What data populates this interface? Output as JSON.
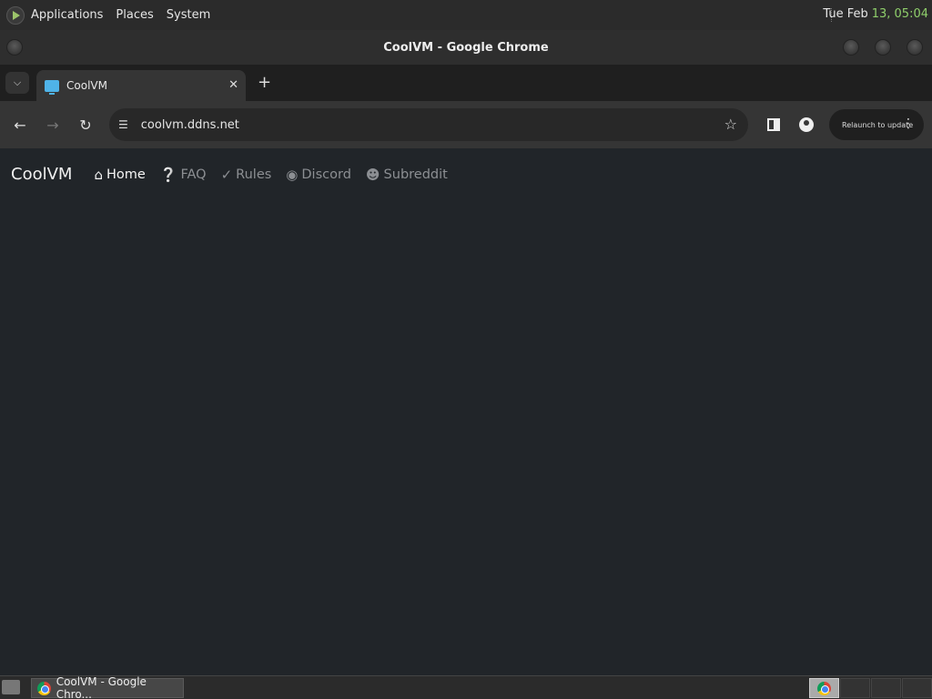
{
  "top_panel": {
    "menus": [
      "Applications",
      "Places",
      "System"
    ],
    "clock_date": "Tue Feb",
    "clock_time": "13, 05:04"
  },
  "window": {
    "title": "CoolVM - Google Chrome"
  },
  "browser": {
    "tab_title": "CoolVM",
    "tab_close": "✕",
    "new_tab": "+",
    "url": "coolvm.ddns.net",
    "relaunch_label": "Relaunch to update"
  },
  "page": {
    "brand": "CoolVM",
    "nav": [
      {
        "label": "Home",
        "icon": "home-icon",
        "active": true
      },
      {
        "label": "FAQ",
        "icon": "question-circle-icon",
        "active": false
      },
      {
        "label": "Rules",
        "icon": "clipboard-check-icon",
        "active": false
      },
      {
        "label": "Discord",
        "icon": "discord-icon",
        "active": false
      },
      {
        "label": "Subreddit",
        "icon": "reddit-icon",
        "active": false
      }
    ]
  },
  "taskbar": {
    "task_label": "CoolVM - Google Chro..."
  },
  "colors": {
    "page_bg": "#212529",
    "clock_time": "#8fcf6b",
    "nav_active": "#f5f5f5",
    "nav_inactive": "#8c8f93"
  }
}
